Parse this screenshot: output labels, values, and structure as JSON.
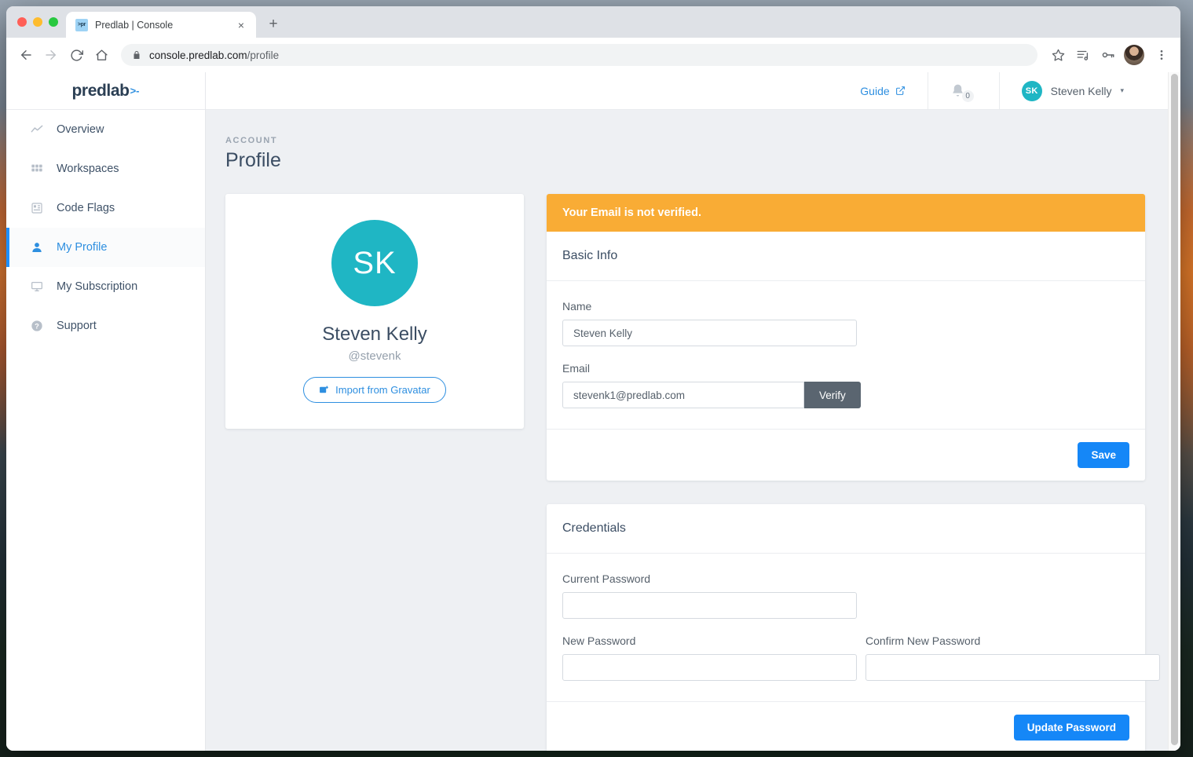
{
  "browser": {
    "tab": {
      "title": "Predlab | Console",
      "favicon_label": ">pr",
      "close_label": "×"
    },
    "new_tab_label": "+",
    "url": {
      "host": "console.predlab.com",
      "path": "/profile"
    },
    "icons": {
      "back": "back-arrow-icon",
      "forward": "forward-arrow-icon",
      "reload": "reload-icon",
      "home": "home-icon",
      "lock": "lock-icon",
      "bookmark": "star-icon",
      "media": "media-list-icon",
      "password": "key-icon",
      "profile": "browser-profile-avatar",
      "menu": "three-dot-menu-icon"
    }
  },
  "sidebar": {
    "logo": {
      "text": "predlab",
      "mark": ">-"
    },
    "items": [
      {
        "label": "Overview",
        "icon": "line-chart-icon",
        "active": false
      },
      {
        "label": "Workspaces",
        "icon": "grid-icon",
        "active": false
      },
      {
        "label": "Code Flags",
        "icon": "flags-list-icon",
        "active": false
      },
      {
        "label": "My Profile",
        "icon": "person-icon",
        "active": true
      },
      {
        "label": "My Subscription",
        "icon": "monitor-icon",
        "active": false
      },
      {
        "label": "Support",
        "icon": "question-circle-icon",
        "active": false
      }
    ]
  },
  "topbar": {
    "guide_label": "Guide",
    "guide_icon": "external-link-icon",
    "bell_icon": "bell-icon",
    "notification_count": "0",
    "user": {
      "initials": "SK",
      "name": "Steven Kelly",
      "caret": "▾"
    }
  },
  "page": {
    "eyebrow": "ACCOUNT",
    "title": "Profile"
  },
  "profile_card": {
    "avatar_initials": "SK",
    "name": "Steven Kelly",
    "handle": "@stevenk",
    "gravatar_button": "Import from Gravatar",
    "gravatar_icon": "image-import-icon"
  },
  "basic_info": {
    "alert": "Your Email is not verified.",
    "alert_color": "#f9ac35",
    "heading": "Basic Info",
    "name_label": "Name",
    "name_value": "Steven Kelly",
    "name_placeholder": "Name",
    "email_label": "Email",
    "email_value": "stevenk1@predlab.com",
    "email_placeholder": "Email",
    "verify_button": "Verify",
    "save_button": "Save"
  },
  "credentials": {
    "heading": "Credentials",
    "current_password_label": "Current Password",
    "current_password_value": "",
    "new_password_label": "New Password",
    "new_password_value": "",
    "confirm_password_label": "Confirm New Password",
    "confirm_password_value": "",
    "update_button": "Update Password"
  },
  "colors": {
    "accent_blue": "#1587f7",
    "link_blue": "#2e8fe0",
    "teal": "#1fb6c4",
    "warning": "#f9ac35",
    "dark_slate": "#5a6570",
    "navy_text": "#3b4d63"
  }
}
